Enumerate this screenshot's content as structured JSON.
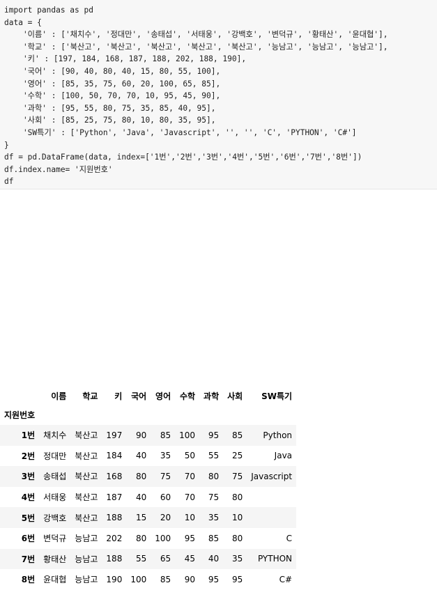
{
  "code": {
    "line1": "import pandas as pd",
    "line2": "data = {",
    "line3": "    '이름' : ['채치수', '정대만', '송태섭', '서태웅', '강백호', '변덕규', '황태산', '윤대협'],",
    "line4": "    '학교' : ['북산고', '북산고', '북산고', '북산고', '북산고', '능남고', '능남고', '능남고'],",
    "line5": "    '키' : [197, 184, 168, 187, 188, 202, 188, 190],",
    "line6": "    '국어' : [90, 40, 80, 40, 15, 80, 55, 100],",
    "line7": "    '영어' : [85, 35, 75, 60, 20, 100, 65, 85],",
    "line8": "    '수학' : [100, 50, 70, 70, 10, 95, 45, 90],",
    "line9": "    '과학' : [95, 55, 80, 75, 35, 85, 40, 95],",
    "line10": "    '사회' : [85, 25, 75, 80, 10, 80, 35, 95],",
    "line11": "    'SW특기' : ['Python', 'Java', 'Javascript', '', '', 'C', 'PYTHON', 'C#']",
    "line12": "}",
    "line13": "df = pd.DataFrame(data, index=['1번','2번','3번','4번','5번','6번','7번','8번'])",
    "line14": "df.index.name= '지원번호'",
    "line15": "df"
  },
  "table": {
    "columns": [
      "이름",
      "학교",
      "키",
      "국어",
      "영어",
      "수학",
      "과학",
      "사회",
      "SW특기"
    ],
    "index_name": "지원번호",
    "rows": [
      {
        "idx": "1번",
        "cells": [
          "채치수",
          "북산고",
          "197",
          "90",
          "85",
          "100",
          "95",
          "85",
          "Python"
        ]
      },
      {
        "idx": "2번",
        "cells": [
          "정대만",
          "북산고",
          "184",
          "40",
          "35",
          "50",
          "55",
          "25",
          "Java"
        ]
      },
      {
        "idx": "3번",
        "cells": [
          "송태섭",
          "북산고",
          "168",
          "80",
          "75",
          "70",
          "80",
          "75",
          "Javascript"
        ]
      },
      {
        "idx": "4번",
        "cells": [
          "서태웅",
          "북산고",
          "187",
          "40",
          "60",
          "70",
          "75",
          "80",
          ""
        ]
      },
      {
        "idx": "5번",
        "cells": [
          "강백호",
          "북산고",
          "188",
          "15",
          "20",
          "10",
          "35",
          "10",
          ""
        ]
      },
      {
        "idx": "6번",
        "cells": [
          "변덕규",
          "능남고",
          "202",
          "80",
          "100",
          "95",
          "85",
          "80",
          "C"
        ]
      },
      {
        "idx": "7번",
        "cells": [
          "황태산",
          "능남고",
          "188",
          "55",
          "65",
          "45",
          "40",
          "35",
          "PYTHON"
        ]
      },
      {
        "idx": "8번",
        "cells": [
          "윤대협",
          "능남고",
          "190",
          "100",
          "85",
          "90",
          "95",
          "95",
          "C#"
        ]
      }
    ]
  }
}
